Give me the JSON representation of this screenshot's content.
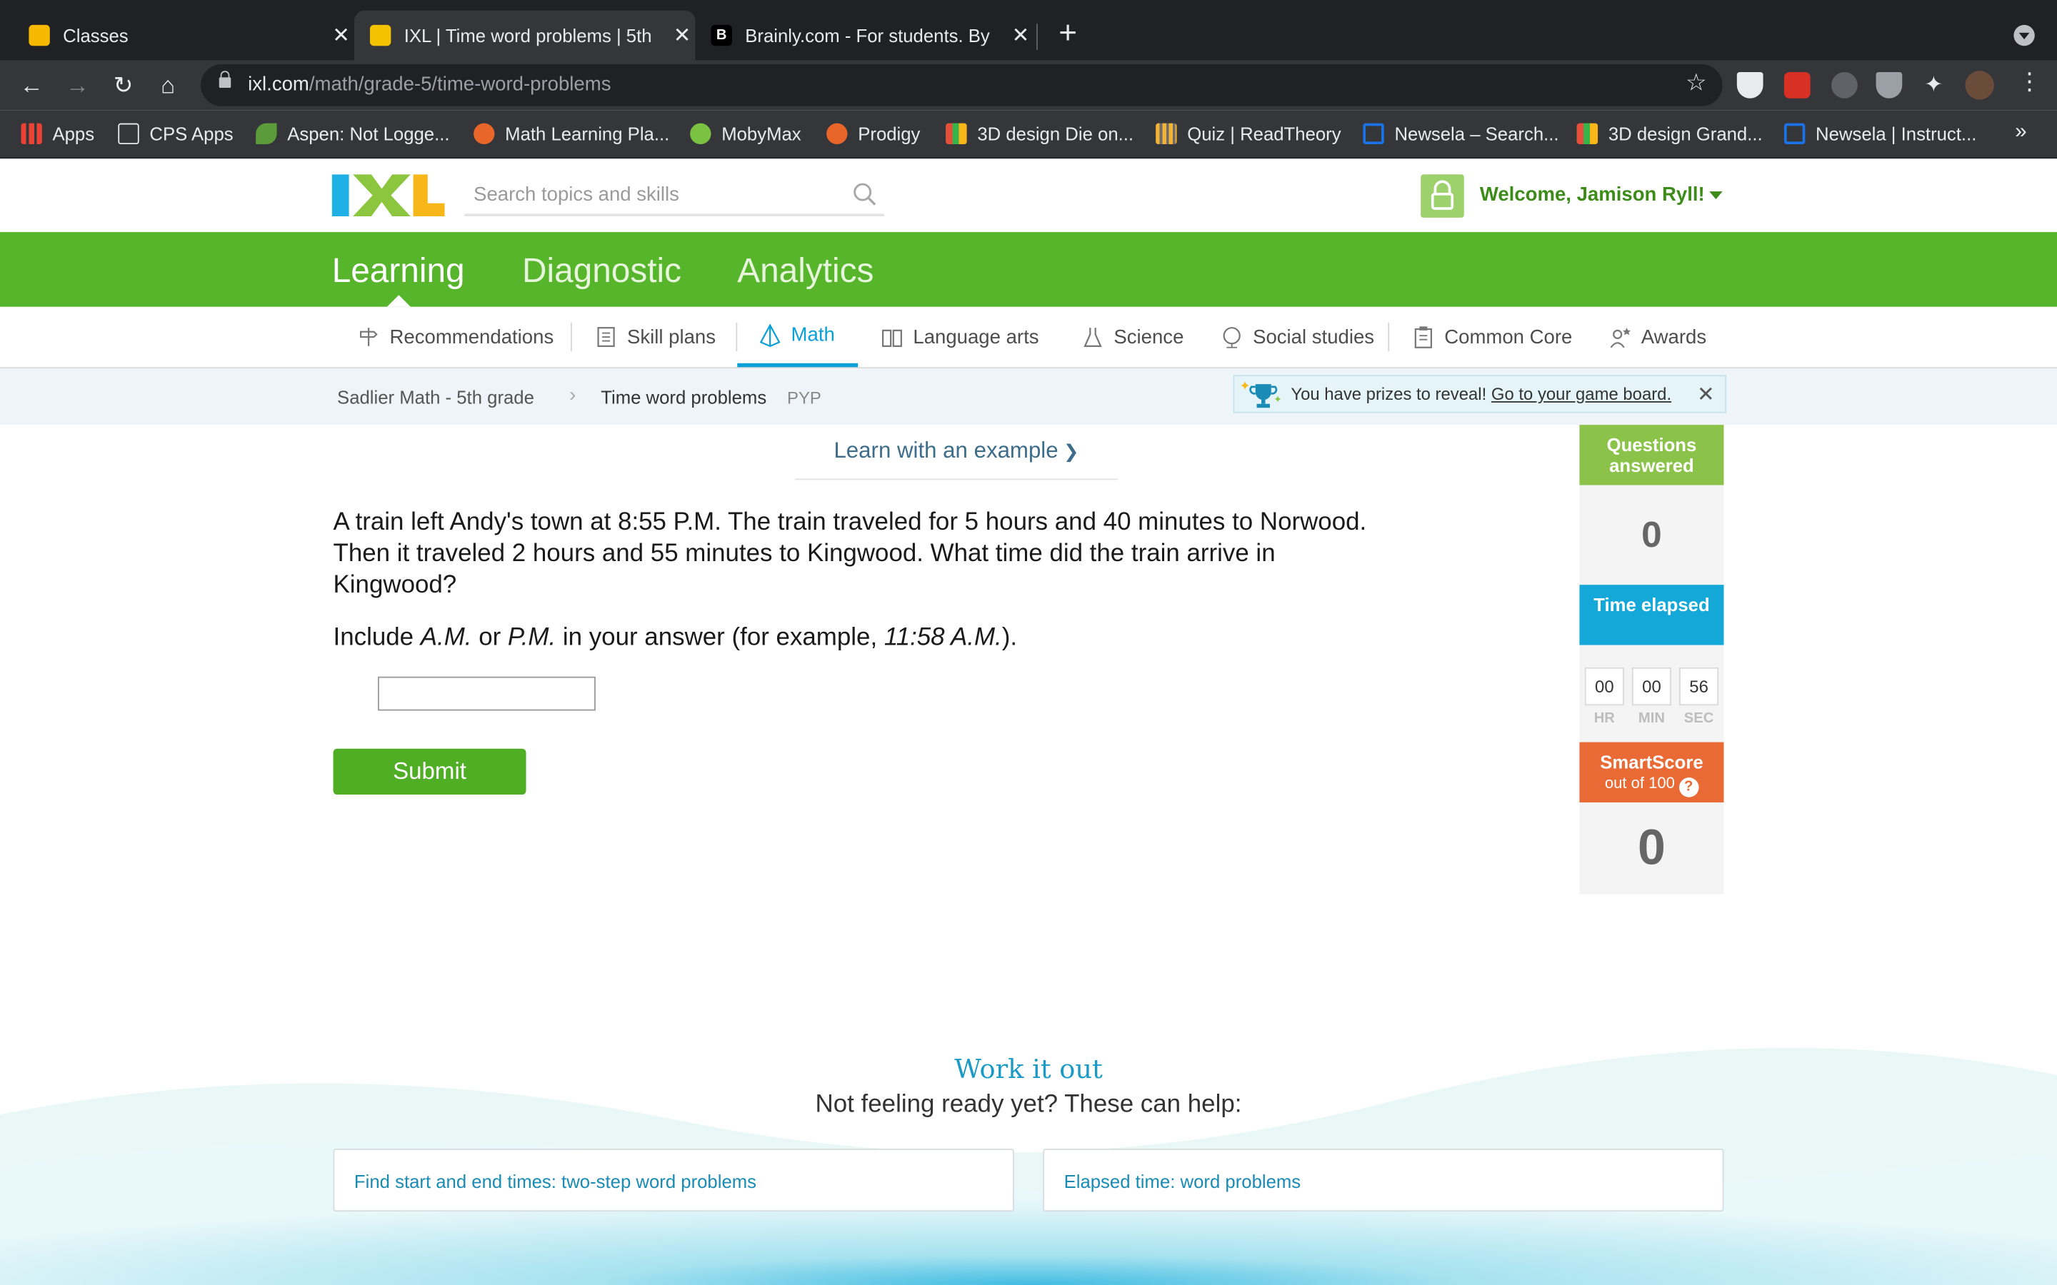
{
  "browser": {
    "tabs": [
      {
        "title": "Classes",
        "active": false
      },
      {
        "title": "IXL | Time word problems | 5th",
        "active": true
      },
      {
        "title": "Brainly.com - For students. By",
        "active": false
      }
    ],
    "url_host": "ixl.com",
    "url_path": "/math/grade-5/time-word-problems",
    "bookmarks": [
      "Apps",
      "CPS Apps",
      "Aspen: Not Logge...",
      "Math Learning Pla...",
      "MobyMax",
      "Prodigy",
      "3D design Die on...",
      "Quiz | ReadTheory",
      "Newsela – Search...",
      "3D design Grand...",
      "Newsela | Instruct..."
    ]
  },
  "header": {
    "search_placeholder": "Search topics and skills",
    "welcome": "Welcome, Jamison Ryll!"
  },
  "main_nav": [
    "Learning",
    "Diagnostic",
    "Analytics"
  ],
  "subject_nav": [
    "Recommendations",
    "Skill plans",
    "Math",
    "Language arts",
    "Science",
    "Social studies",
    "Common Core",
    "Awards"
  ],
  "breadcrumb": {
    "parent": "Sadlier Math - 5th grade",
    "current": "Time word problems",
    "code": "PYP"
  },
  "prize_banner": {
    "text": "You have prizes to reveal!",
    "link": "Go to your game board."
  },
  "question": {
    "learn_link": "Learn with an example",
    "text": "A train left Andy's town at 8:55 P.M. The train traveled for 5 hours and 40 minutes to Norwood. Then it traveled 2 hours and 55 minutes to Kingwood. What time did the train arrive in Kingwood?",
    "include_pre": "Include ",
    "am": "A.M.",
    "or": " or ",
    "pm": "P.M.",
    "include_mid": " in your answer (for example, ",
    "example": "11:58 A.M.",
    "include_end": ").",
    "answer_value": "",
    "submit_label": "Submit"
  },
  "stats": {
    "questions_label": "Questions answered",
    "questions_value": "0",
    "time_label": "Time elapsed",
    "hr": "00",
    "min": "00",
    "sec": "56",
    "hr_label": "HR",
    "min_label": "MIN",
    "sec_label": "SEC",
    "smartscore_label": "SmartScore",
    "smartscore_sub": "out of 100",
    "smartscore_value": "0"
  },
  "help": {
    "title": "Work it out",
    "subtitle": "Not feeling ready yet? These can help:",
    "cards": [
      "Find start and end times: two-step word problems",
      "Elapsed time: word problems"
    ]
  },
  "colors": {
    "ixl_green": "#56b52a",
    "submit_green": "#4fae24",
    "math_blue": "#0a9fd6",
    "stat_green": "#8bc34a",
    "stat_blue": "#14a8d8",
    "stat_orange": "#ea6a35"
  }
}
